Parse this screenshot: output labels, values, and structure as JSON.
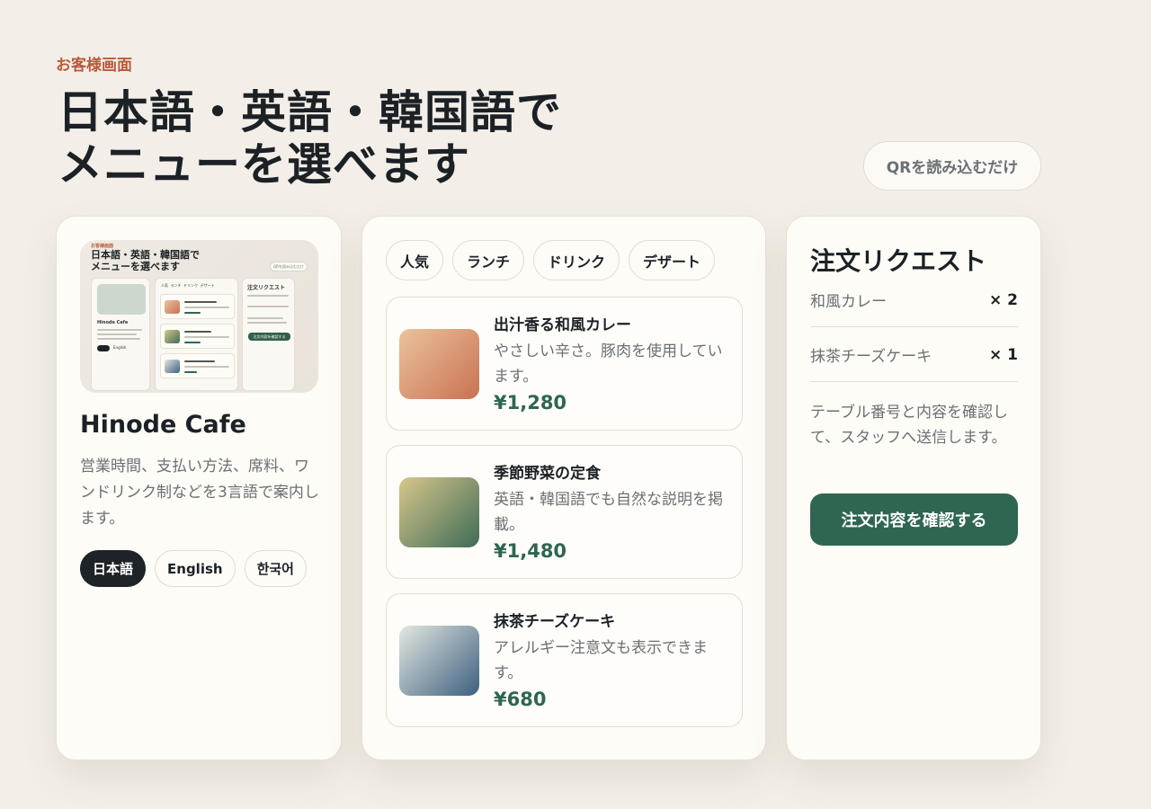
{
  "header": {
    "eyebrow": "お客様画面",
    "title_line1": "日本語・英語・韓国語で",
    "title_line2": "メニューを選べます",
    "qr_label": "QRを読み込むだけ"
  },
  "info_card": {
    "cafe_name": "Hinode Cafe",
    "description": "営業時間、支払い方法、席料、ワンドリンク制などを3言語で案内します。",
    "languages": [
      {
        "label": "日本語",
        "active": true
      },
      {
        "label": "English",
        "active": false
      },
      {
        "label": "한국어",
        "active": false
      }
    ],
    "preview": {
      "eyebrow": "お客様画面",
      "title_line1": "日本語・英語・韓国語で",
      "title_line2": "メニューを選べます",
      "qr_label": "QRを読み込むだけ",
      "cafe_name": "Hinode Cafe",
      "lang_en": "English",
      "tabs": [
        "人気",
        "ランチ",
        "ドリンク",
        "デザート"
      ],
      "order_title": "注文リクエスト",
      "button": "注文内容を確認する"
    }
  },
  "menu": {
    "tabs": [
      "人気",
      "ランチ",
      "ドリンク",
      "デザート"
    ],
    "items": [
      {
        "name": "出汁香る和風カレー",
        "description": "やさしい辛さ。豚肉を使用しています。",
        "price": "¥1,280",
        "swatch": [
          "#ebc29d",
          "#c97252"
        ]
      },
      {
        "name": "季節野菜の定食",
        "description": "英語・韓国語でも自然な説明を掲載。",
        "price": "¥1,480",
        "swatch": [
          "#d7c78b",
          "#3f6b56"
        ]
      },
      {
        "name": "抹茶チーズケーキ",
        "description": "アレルギー注意文も表示できます。",
        "price": "¥680",
        "swatch": [
          "#e4e8e1",
          "#3d5f7f"
        ]
      }
    ]
  },
  "order": {
    "title": "注文リクエスト",
    "rows": [
      {
        "name": "和風カレー",
        "qty": "× 2"
      },
      {
        "name": "抹茶チーズケーキ",
        "qty": "× 1"
      }
    ],
    "note": "テーブル番号と内容を確認して、スタッフへ送信します。",
    "confirm_label": "注文内容を確認する"
  },
  "colors": {
    "accent": "#2f6651",
    "eyebrow": "#b85a3c",
    "dark": "#1e2328"
  }
}
